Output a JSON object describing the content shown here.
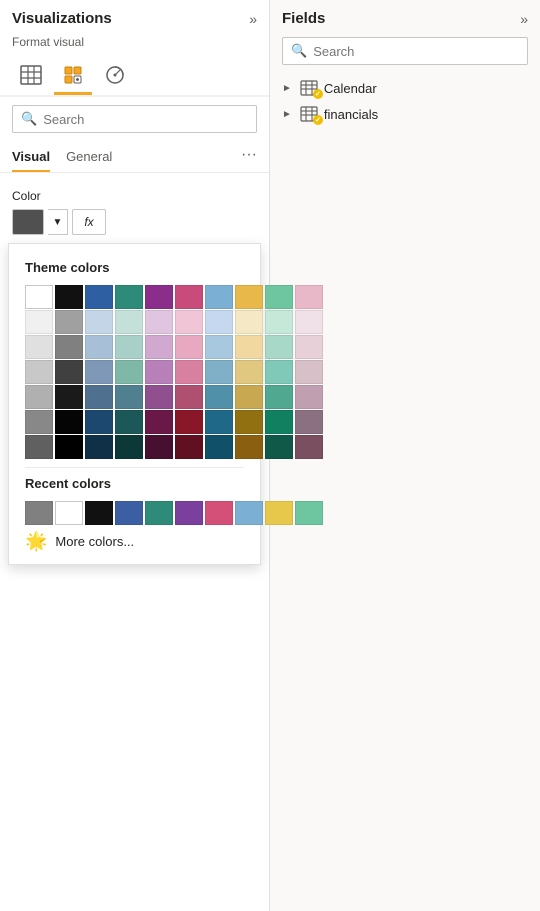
{
  "left_panel": {
    "title": "Visualizations",
    "format_visual_label": "Format visual",
    "search_placeholder": "Search",
    "tabs": [
      {
        "id": "visual",
        "label": "Visual",
        "active": true
      },
      {
        "id": "general",
        "label": "General",
        "active": false
      }
    ],
    "tabs_more": "···",
    "color_section": {
      "label": "Color",
      "swatch_color": "#505050",
      "fx_label": "fx"
    },
    "color_picker": {
      "theme_section_title": "Theme colors",
      "theme_rows": [
        [
          "#ffffff",
          "#111111",
          "#2e5fa3",
          "#2e8b79",
          "#8b2e8b",
          "#c94b7b",
          "#7bafd4",
          "#e8b84b",
          "#6ec6a0",
          "#e8b8c8"
        ],
        [
          "#f0f0f0",
          "#808080",
          "#c5d5e8",
          "#c5e0d8",
          "#e0c5e0",
          "#f0c5d5",
          "#c5d8e8",
          "#f5e8c5",
          "#c5e8d8",
          "#f0e0e8"
        ],
        [
          "#e0e0e0",
          "#606060",
          "#a8c0d8",
          "#a8d0c8",
          "#d0a8d0",
          "#e8a8c0",
          "#a8c8d8",
          "#f0d8a0",
          "#a8d8c8",
          "#e8d0d8"
        ],
        [
          "#d0d0d0",
          "#404040",
          "#8098b8",
          "#80b8a8",
          "#b880b8",
          "#d880a0",
          "#80b0c8",
          "#e0c880",
          "#80c8b8",
          "#d8c0c8"
        ],
        [
          "#b0b0b0",
          "#202020",
          "#507090",
          "#508090",
          "#905090",
          "#b05070",
          "#5090a8",
          "#c8a850",
          "#50a890",
          "#c0a0b0"
        ],
        [
          "#808080",
          "#080808",
          "#205868",
          "#205868",
          "#682058",
          "#882038",
          "#2070888",
          "#a07820",
          "#209870",
          "#a08090"
        ],
        [
          "#606060",
          "#000000",
          "#103048",
          "#103848",
          "#481030",
          "#601020",
          "#105068",
          "#806010",
          "#108060",
          "#806070"
        ]
      ],
      "recent_section_title": "Recent colors",
      "recent_colors": [
        "#808080",
        "#ffffff",
        "#111111",
        "#3c5fa3",
        "#2e8b79",
        "#7b3f9e",
        "#d45078",
        "#7bafd4",
        "#e8c84b",
        "#6ec6a0"
      ],
      "more_colors_label": "More colors..."
    }
  },
  "right_panel": {
    "title": "Fields",
    "search_placeholder": "Search",
    "fields": [
      {
        "id": "calendar",
        "label": "Calendar",
        "has_badge": true
      },
      {
        "id": "financials",
        "label": "financials",
        "has_badge": true
      }
    ]
  },
  "icons": {
    "expand": "»",
    "search": "🔍",
    "chevron_right": "›",
    "table_icon": "⊞",
    "more": "···",
    "palette": "🎨",
    "dropdown_arrow": "▾"
  }
}
